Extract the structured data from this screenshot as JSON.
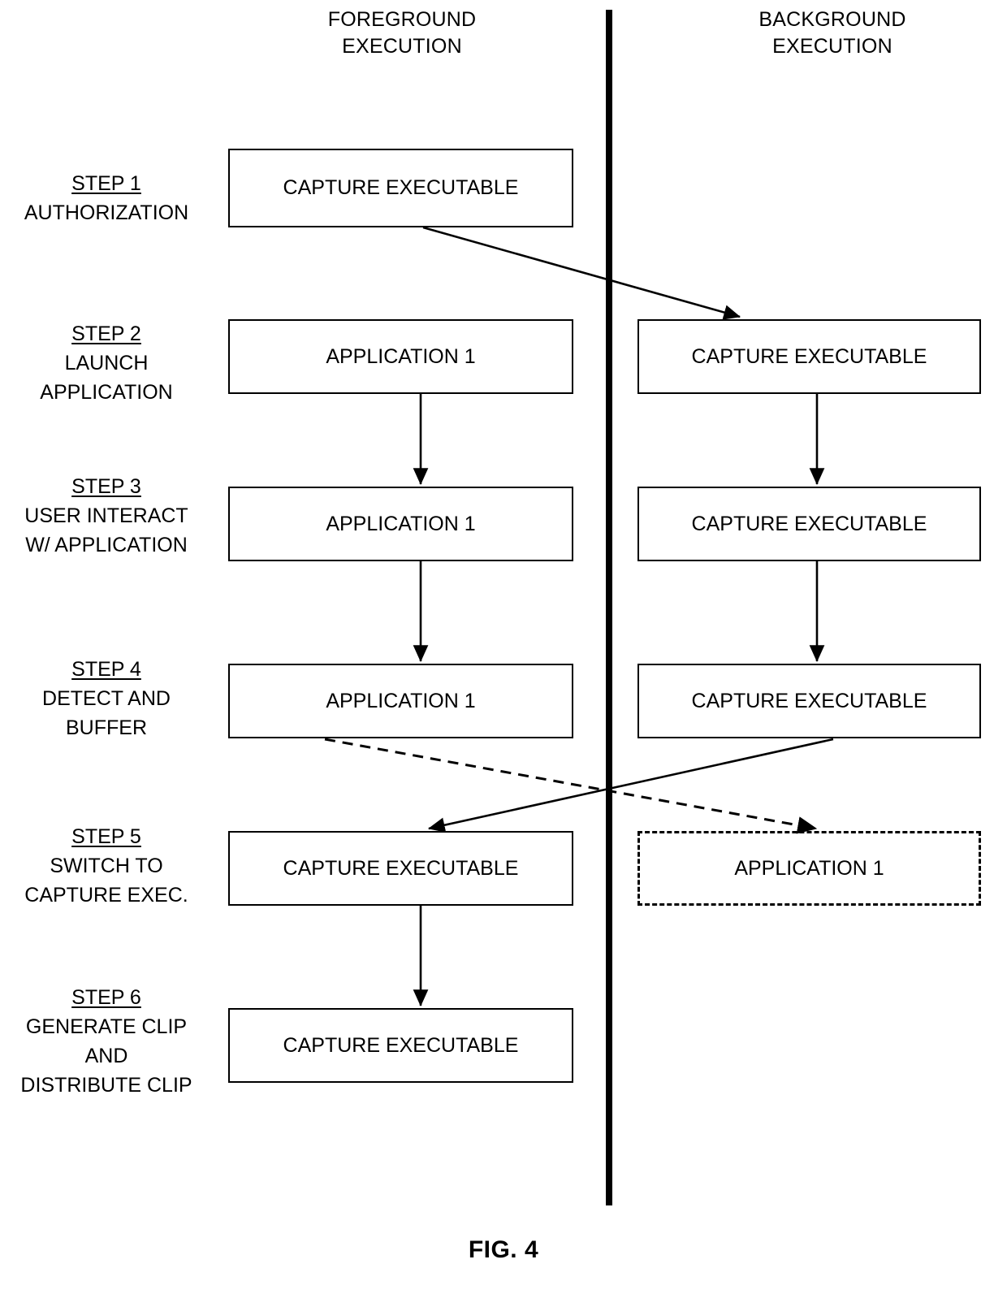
{
  "figure": {
    "caption": "FIG. 4"
  },
  "columns": [
    {
      "id": "foreground",
      "title": "FOREGROUND\nEXECUTION"
    },
    {
      "id": "background",
      "title": "BACKGROUND\nEXECUTION"
    }
  ],
  "steps": [
    {
      "number": "STEP 1",
      "description": "AUTHORIZATION"
    },
    {
      "number": "STEP 2",
      "description": "LAUNCH\nAPPLICATION"
    },
    {
      "number": "STEP 3",
      "description": "USER INTERACT\nW/ APPLICATION"
    },
    {
      "number": "STEP 4",
      "description": "DETECT AND\nBUFFER"
    },
    {
      "number": "STEP 5",
      "description": "SWITCH TO\nCAPTURE EXEC."
    },
    {
      "number": "STEP 6",
      "description": "GENERATE CLIP\nAND\nDISTRIBUTE CLIP"
    }
  ],
  "boxes": [
    {
      "id": "s1-fg",
      "step": "STEP 1",
      "column": "foreground",
      "label": "CAPTURE EXECUTABLE",
      "border": "solid"
    },
    {
      "id": "s2-fg",
      "step": "STEP 2",
      "column": "foreground",
      "label": "APPLICATION 1",
      "border": "solid"
    },
    {
      "id": "s2-bg",
      "step": "STEP 2",
      "column": "background",
      "label": "CAPTURE EXECUTABLE",
      "border": "solid"
    },
    {
      "id": "s3-fg",
      "step": "STEP 3",
      "column": "foreground",
      "label": "APPLICATION 1",
      "border": "solid"
    },
    {
      "id": "s3-bg",
      "step": "STEP 3",
      "column": "background",
      "label": "CAPTURE EXECUTABLE",
      "border": "solid"
    },
    {
      "id": "s4-fg",
      "step": "STEP 4",
      "column": "foreground",
      "label": "APPLICATION 1",
      "border": "solid"
    },
    {
      "id": "s4-bg",
      "step": "STEP 4",
      "column": "background",
      "label": "CAPTURE EXECUTABLE",
      "border": "solid"
    },
    {
      "id": "s5-fg",
      "step": "STEP 5",
      "column": "foreground",
      "label": "CAPTURE EXECUTABLE",
      "border": "solid"
    },
    {
      "id": "s5-bg",
      "step": "STEP 5",
      "column": "background",
      "label": "APPLICATION 1",
      "border": "dashed"
    },
    {
      "id": "s6-fg",
      "step": "STEP 6",
      "column": "foreground",
      "label": "CAPTURE EXECUTABLE",
      "border": "solid"
    }
  ],
  "connectors": [
    {
      "id": "s1fg-to-s2bg",
      "from": "s1-fg",
      "to": "s2-bg",
      "style": "solid"
    },
    {
      "id": "s2fg-to-s3fg",
      "from": "s2-fg",
      "to": "s3-fg",
      "style": "solid"
    },
    {
      "id": "s2bg-to-s3bg",
      "from": "s2-bg",
      "to": "s3-bg",
      "style": "solid"
    },
    {
      "id": "s3fg-to-s4fg",
      "from": "s3-fg",
      "to": "s4-fg",
      "style": "solid"
    },
    {
      "id": "s3bg-to-s4bg",
      "from": "s3-bg",
      "to": "s4-bg",
      "style": "solid"
    },
    {
      "id": "s4fg-to-s5bg",
      "from": "s4-fg",
      "to": "s5-bg",
      "style": "dashed"
    },
    {
      "id": "s4bg-to-s5fg",
      "from": "s4-bg",
      "to": "s5-fg",
      "style": "solid"
    },
    {
      "id": "s5fg-to-s6fg",
      "from": "s5-fg",
      "to": "s6-fg",
      "style": "solid"
    }
  ],
  "colors": {
    "line": "#000000",
    "background": "#ffffff"
  }
}
